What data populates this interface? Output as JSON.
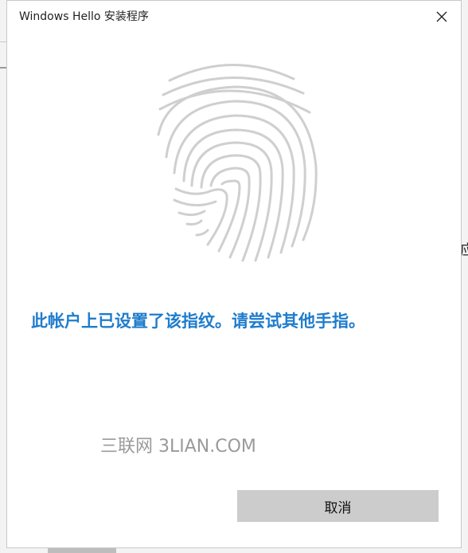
{
  "dialog": {
    "title": "Windows Hello 安装程序",
    "close_icon": "close-icon",
    "fingerprint_icon": "fingerprint-icon",
    "message": "此帐户上已设置了该指纹。请尝试其他手指。",
    "cancel_label": "取消",
    "message_color": "#1f7ccc",
    "cancel_button_color": "#cccccc"
  },
  "watermark": {
    "text": "三联网 3LIAN.COM"
  },
  "background": {
    "partial_glyph": "应"
  }
}
